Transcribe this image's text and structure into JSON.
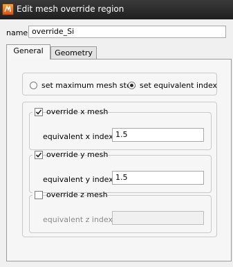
{
  "window": {
    "title": "Edit mesh override region",
    "icon": "app-logo-icon"
  },
  "name_field": {
    "label": "name",
    "value": "override_Si"
  },
  "tabs": [
    {
      "label": "General",
      "active": true
    },
    {
      "label": "Geometry",
      "active": false
    }
  ],
  "mesh_mode": {
    "options": [
      {
        "label": "set maximum mesh step",
        "selected": false
      },
      {
        "label": "set equivalent index",
        "selected": true
      }
    ]
  },
  "overrides": [
    {
      "label": "override x mesh",
      "checked": true,
      "field_label": "equivalent x index",
      "value": "1.5",
      "enabled": true
    },
    {
      "label": "override y mesh",
      "checked": true,
      "field_label": "equivalent y index",
      "value": "1.5",
      "enabled": true
    },
    {
      "label": "override z mesh",
      "checked": false,
      "field_label": "equivalent z index",
      "value": "",
      "enabled": false
    }
  ]
}
